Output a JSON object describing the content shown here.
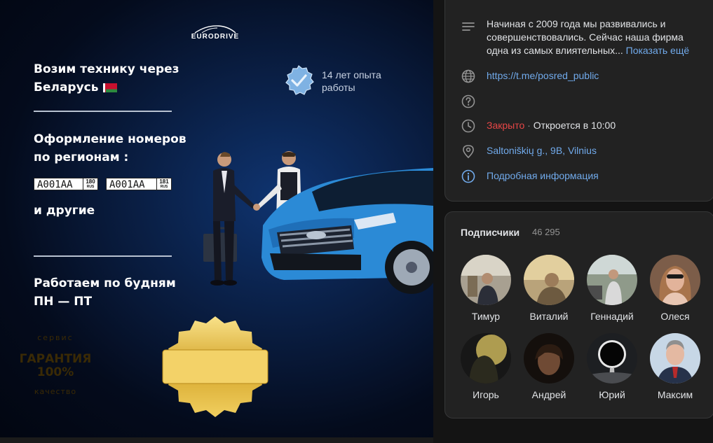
{
  "banner": {
    "logo": "EURODRIVE",
    "line1": "Возим технику через",
    "line2": "Беларусь",
    "plates_line1": "Оформление номеров",
    "plates_line2": "по регионам :",
    "plate1": {
      "number": "А001АА",
      "region": "180",
      "country": "RUS"
    },
    "plate2": {
      "number": "А001АА",
      "region": "181",
      "country": "RUS"
    },
    "others": "и другие",
    "schedule1": "Работаем по будням",
    "schedule2": "ПН — ПТ",
    "experience1": "14 лет опыта",
    "experience2": "работы",
    "seal_top": "сервис",
    "seal_main1": "ГАРАНТИЯ",
    "seal_main2": "100%",
    "seal_bottom": "качество"
  },
  "info": {
    "description1": "Начиная с 2009 года мы развивались и",
    "description2": "совершенствовались. Сейчас наша фирма",
    "description3": "одна из самых влиятельных...",
    "show_more": "Показать ещё",
    "website": "https://t.me/posred_public",
    "status_closed": "Закрыто",
    "status_sep": " · ",
    "status_opens": "Откроется в 10:00",
    "address": "Saltoniškių g., 9B, Vilnius",
    "details": "Подробная информация"
  },
  "subscribers": {
    "title": "Подписчики",
    "count": "46 295",
    "people": [
      {
        "name": "Тимур"
      },
      {
        "name": "Виталий"
      },
      {
        "name": "Геннадий"
      },
      {
        "name": "Олеся"
      },
      {
        "name": "Игорь"
      },
      {
        "name": "Андрей"
      },
      {
        "name": "Юрий"
      },
      {
        "name": "Максим"
      }
    ]
  },
  "colors": {
    "link": "#71aaeb",
    "closed": "#e64646",
    "card": "#222222",
    "page": "#141414"
  }
}
